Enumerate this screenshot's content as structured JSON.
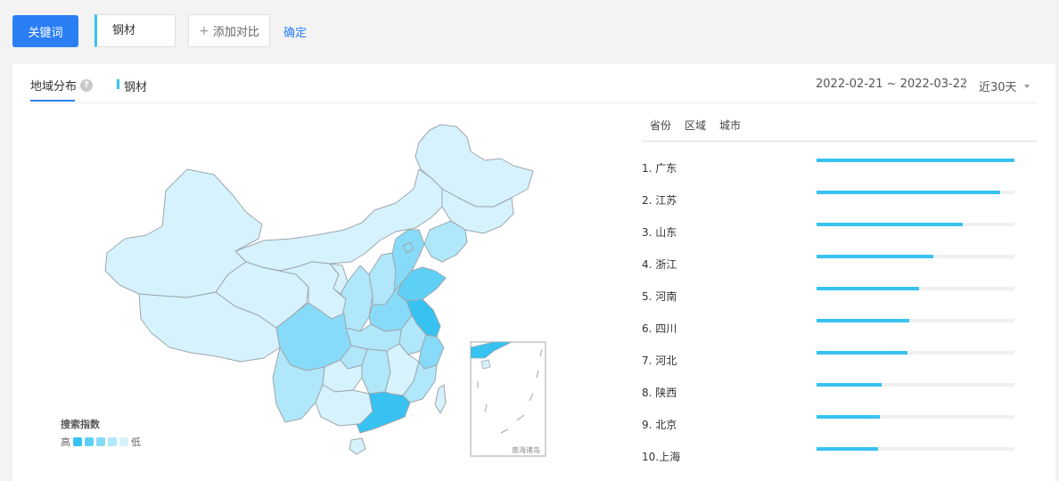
{
  "toolbar": {
    "keyword_button": "关键词",
    "keyword_value": "钢材",
    "add_compare": "添加对比",
    "confirm": "确定"
  },
  "panel": {
    "tab_title": "地域分布",
    "help_icon": "?",
    "series_name": "钢材",
    "date_range": "2022-02-21 ~ 2022-03-22",
    "period": "近30天"
  },
  "map": {
    "legend_title": "搜索指数",
    "legend_high": "高",
    "legend_low": "低",
    "legend_colors": [
      "#37c2f2",
      "#5fd0f5",
      "#88dbf8",
      "#b0e7fa",
      "#d6f2fc"
    ],
    "inset_label": "南海诸岛"
  },
  "ranking": {
    "tabs": [
      "省份",
      "区域",
      "城市"
    ],
    "items": [
      {
        "rank": "1.",
        "name": "广东",
        "value": 1.0
      },
      {
        "rank": "2.",
        "name": "江苏",
        "value": 0.93
      },
      {
        "rank": "3.",
        "name": "山东",
        "value": 0.74
      },
      {
        "rank": "4.",
        "name": "浙江",
        "value": 0.59
      },
      {
        "rank": "5.",
        "name": "河南",
        "value": 0.52
      },
      {
        "rank": "6.",
        "name": "四川",
        "value": 0.47
      },
      {
        "rank": "7.",
        "name": "河北",
        "value": 0.46
      },
      {
        "rank": "8.",
        "name": "陕西",
        "value": 0.33
      },
      {
        "rank": "9.",
        "name": "北京",
        "value": 0.32
      },
      {
        "rank": "10.",
        "name": "上海",
        "value": 0.31
      }
    ]
  }
}
